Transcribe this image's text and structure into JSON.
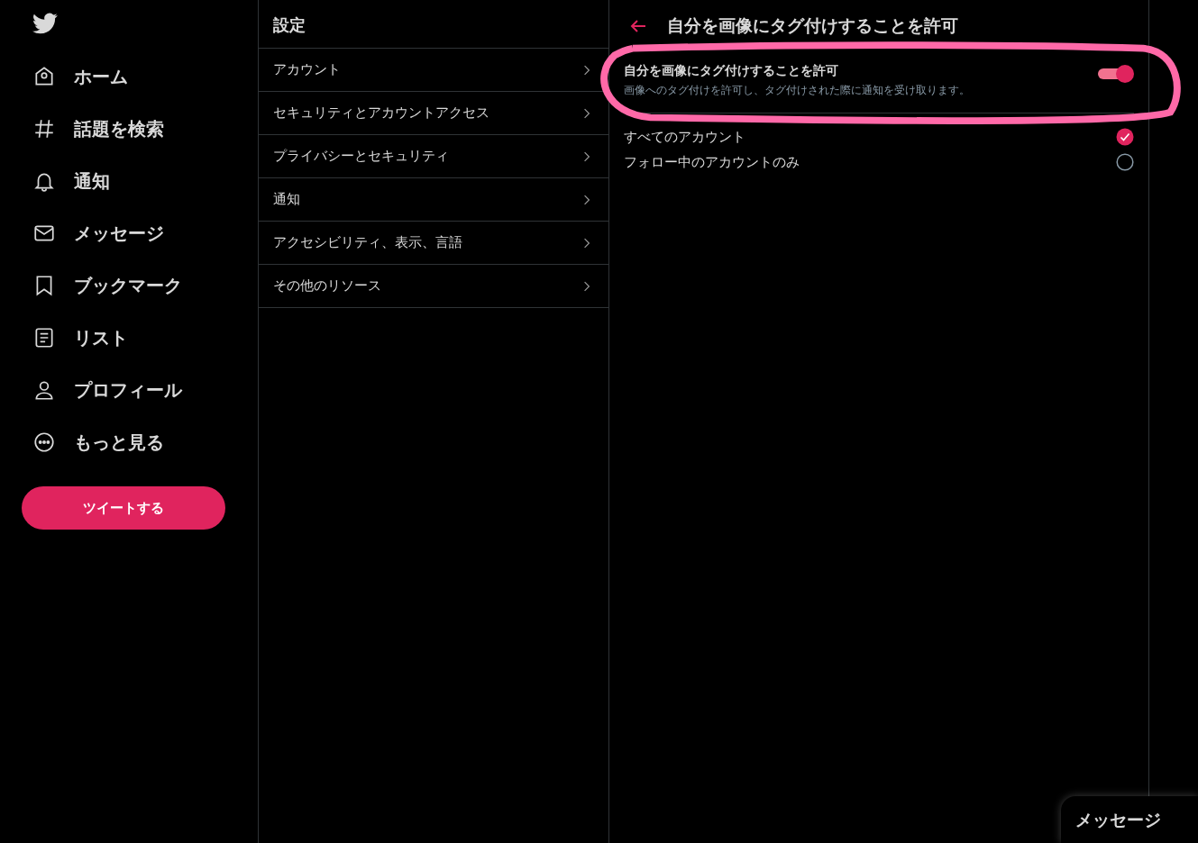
{
  "nav": {
    "items": [
      {
        "label": "ホーム"
      },
      {
        "label": "話題を検索"
      },
      {
        "label": "通知"
      },
      {
        "label": "メッセージ"
      },
      {
        "label": "ブックマーク"
      },
      {
        "label": "リスト"
      },
      {
        "label": "プロフィール"
      },
      {
        "label": "もっと見る"
      }
    ],
    "tweet_button": "ツイートする"
  },
  "settings": {
    "title": "設定",
    "items": [
      {
        "label": "アカウント"
      },
      {
        "label": "セキュリティとアカウントアクセス"
      },
      {
        "label": "プライバシーとセキュリティ"
      },
      {
        "label": "通知"
      },
      {
        "label": "アクセシビリティ、表示、言語"
      },
      {
        "label": "その他のリソース"
      }
    ]
  },
  "detail": {
    "title": "自分を画像にタグ付けすることを許可",
    "toggle": {
      "label": "自分を画像にタグ付けすることを許可",
      "description": "画像へのタグ付けを許可し、タグ付けされた際に通知を受け取ります。",
      "on": true
    },
    "options": [
      {
        "label": "すべてのアカウント",
        "selected": true
      },
      {
        "label": "フォロー中のアカウントのみ",
        "selected": false
      }
    ]
  },
  "message_drawer": {
    "title": "メッセージ"
  }
}
